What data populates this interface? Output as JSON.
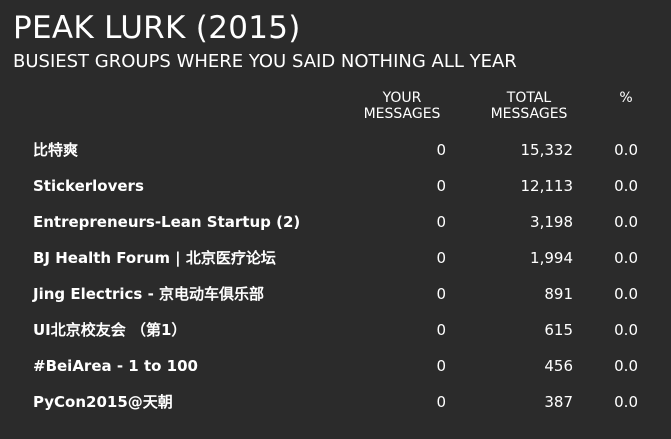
{
  "header": {
    "title": "PEAK LURK (2015)",
    "subtitle": "BUSIEST GROUPS WHERE YOU SAID NOTHING ALL YEAR"
  },
  "columns": {
    "your_messages": [
      "YOUR",
      "MESSAGES"
    ],
    "total_messages": [
      "TOTAL",
      "MESSAGES"
    ],
    "percent": "%"
  },
  "rows": [
    {
      "name": "比特爽",
      "your_messages": "0",
      "total_messages": "15,332",
      "percent": "0.0"
    },
    {
      "name": "Stickerlovers",
      "your_messages": "0",
      "total_messages": "12,113",
      "percent": "0.0"
    },
    {
      "name": "Entrepreneurs-Lean Startup (2)",
      "your_messages": "0",
      "total_messages": "3,198",
      "percent": "0.0"
    },
    {
      "name": "BJ Health Forum | 北京医疗论坛",
      "your_messages": "0",
      "total_messages": "1,994",
      "percent": "0.0"
    },
    {
      "name": "Jing Electrics - 京电动车俱乐部",
      "your_messages": "0",
      "total_messages": "891",
      "percent": "0.0"
    },
    {
      "name": "UI北京校友会 （第1）",
      "your_messages": "0",
      "total_messages": "615",
      "percent": "0.0"
    },
    {
      "name": "#BeiArea - 1 to 100",
      "your_messages": "0",
      "total_messages": "456",
      "percent": "0.0"
    },
    {
      "name": "PyCon2015@天朝",
      "your_messages": "0",
      "total_messages": "387",
      "percent": "0.0"
    }
  ]
}
